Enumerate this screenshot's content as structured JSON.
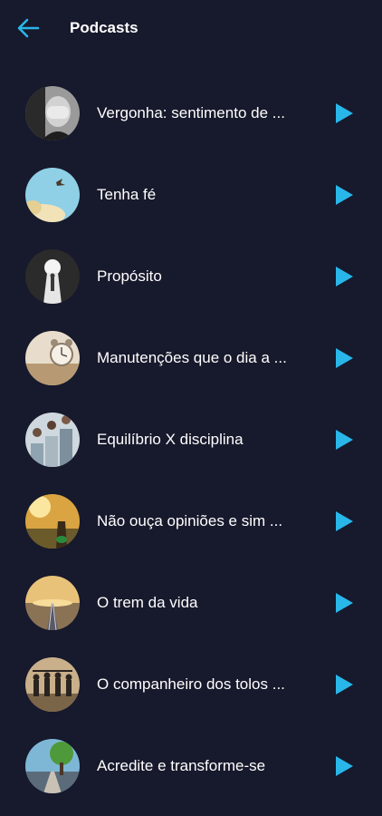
{
  "colors": {
    "background": "#17192c",
    "accent": "#29b6e8",
    "text": "#ffffff"
  },
  "header": {
    "back_icon": "arrow-left-icon",
    "title": "Podcasts"
  },
  "podcasts": [
    {
      "title": "Vergonha: sentimento de ...",
      "thumb": "grayscale portrait, hands over face"
    },
    {
      "title": "Tenha fé",
      "thumb": "bird in blue sky"
    },
    {
      "title": "Propósito",
      "thumb": "figure in keyhole of light"
    },
    {
      "title": "Manutenções que o dia a ...",
      "thumb": "alarm clock"
    },
    {
      "title": "Equilíbrio X disciplina",
      "thumb": "people on stacked blocks"
    },
    {
      "title": "Não ouça opiniões e sim ...",
      "thumb": "runner at sunset"
    },
    {
      "title": "O trem da vida",
      "thumb": "railroad tracks at sunset"
    },
    {
      "title": "O companheiro dos tolos ...",
      "thumb": "friends silhouettes"
    },
    {
      "title": "Acredite e transforme-se",
      "thumb": "tree on road"
    }
  ],
  "play_icon": "play-icon"
}
